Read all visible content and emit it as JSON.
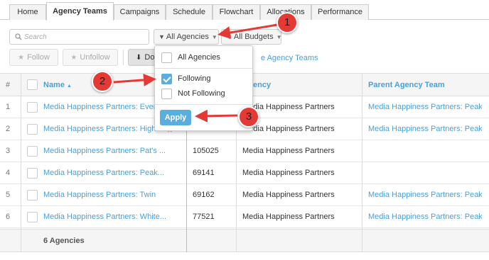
{
  "tabs": [
    {
      "label": "Home",
      "active": false
    },
    {
      "label": "Agency Teams",
      "active": true
    },
    {
      "label": "Campaigns",
      "active": false
    },
    {
      "label": "Schedule",
      "active": false
    },
    {
      "label": "Flowchart",
      "active": false
    },
    {
      "label": "Allocations",
      "active": false
    },
    {
      "label": "Performance",
      "active": false
    }
  ],
  "toolbar": {
    "search_placeholder": "Search",
    "agencies_filter": "All Agencies",
    "budgets_filter": "All Budgets",
    "follow_label": "Follow",
    "unfollow_label": "Unfollow",
    "download_label": "Do",
    "link_tail": "e Agency Teams"
  },
  "dropdown": {
    "options": [
      {
        "label": "All Agencies",
        "checked": false
      },
      {
        "label": "Following",
        "checked": true
      },
      {
        "label": "Not Following",
        "checked": false
      }
    ],
    "apply_label": "Apply"
  },
  "table": {
    "headers": {
      "number": "#",
      "name": "Name",
      "sort_indicator": "▲",
      "agency": "ency",
      "parent": "Parent Agency Team"
    },
    "rows": [
      {
        "num": "1",
        "name": "Media Happiness Partners: Everest",
        "ext": "",
        "agency": "Media Happiness Partners",
        "parent": "Media Happiness Partners: Peak..."
      },
      {
        "num": "2",
        "name": "Media Happiness Partners: Highest",
        "ext": "",
        "agency": "Media Happiness Partners",
        "parent": "Media Happiness Partners: Peak..."
      },
      {
        "num": "3",
        "name": "Media Happiness Partners: Pat's ...",
        "ext": "105025",
        "agency": "Media Happiness Partners",
        "parent": ""
      },
      {
        "num": "4",
        "name": "Media Happiness Partners: Peak...",
        "ext": "69141",
        "agency": "Media Happiness Partners",
        "parent": ""
      },
      {
        "num": "5",
        "name": "Media Happiness Partners: Twin",
        "ext": "69162",
        "agency": "Media Happiness Partners",
        "parent": "Media Happiness Partners: Peak..."
      },
      {
        "num": "6",
        "name": "Media Happiness Partners: White...",
        "ext": "77521",
        "agency": "Media Happiness Partners",
        "parent": "Media Happiness Partners: Peak..."
      }
    ],
    "footer": "6 Agencies"
  },
  "callouts": [
    "1",
    "2",
    "3"
  ],
  "colors": {
    "accent": "#4a9fd6",
    "callout": "#e53935",
    "checked": "#5aaedf"
  }
}
